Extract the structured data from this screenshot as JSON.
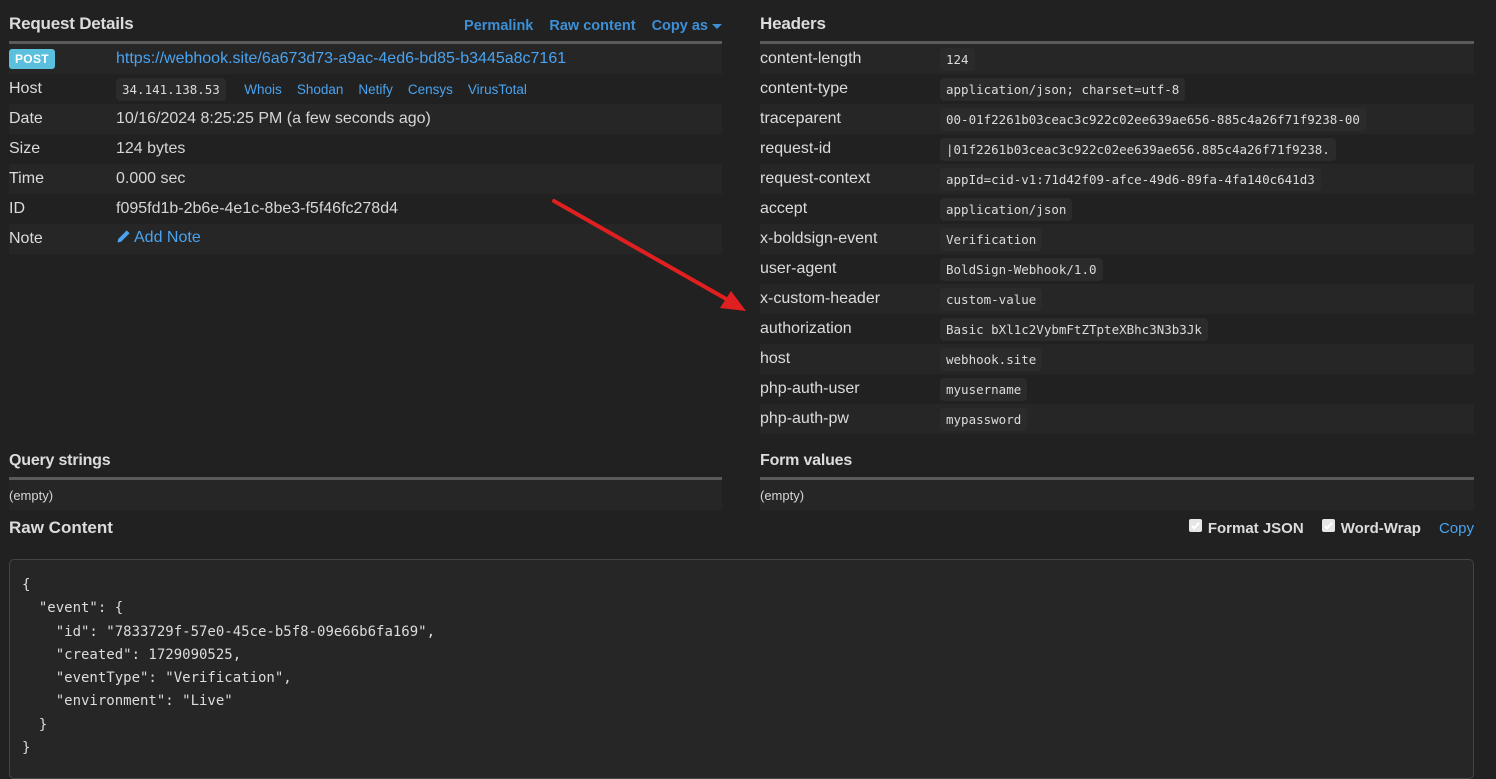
{
  "request_details": {
    "title": "Request Details",
    "links": {
      "permalink": "Permalink",
      "raw_content": "Raw content",
      "copy_as": "Copy as"
    },
    "method": "POST",
    "url": "https://webhook.site/6a673d73-a9ac-4ed6-bd85-b3445a8c7161",
    "host_label": "Host",
    "host_ip": "34.141.138.53",
    "host_links": [
      "Whois",
      "Shodan",
      "Netify",
      "Censys",
      "VirusTotal"
    ],
    "date_label": "Date",
    "date": "10/16/2024 8:25:25 PM (a few seconds ago)",
    "size_label": "Size",
    "size": "124 bytes",
    "time_label": "Time",
    "time": "0.000 sec",
    "id_label": "ID",
    "id": "f095fd1b-2b6e-4e1c-8be3-f5f46fc278d4",
    "note_label": "Note",
    "add_note": "Add Note"
  },
  "headers": {
    "title": "Headers",
    "rows": [
      {
        "key": "content-length",
        "value": "124"
      },
      {
        "key": "content-type",
        "value": "application/json; charset=utf-8"
      },
      {
        "key": "traceparent",
        "value": "00-01f2261b03ceac3c922c02ee639ae656-885c4a26f71f9238-00"
      },
      {
        "key": "request-id",
        "value": "|01f2261b03ceac3c922c02ee639ae656.885c4a26f71f9238."
      },
      {
        "key": "request-context",
        "value": "appId=cid-v1:71d42f09-afce-49d6-89fa-4fa140c641d3"
      },
      {
        "key": "accept",
        "value": "application/json"
      },
      {
        "key": "x-boldsign-event",
        "value": "Verification"
      },
      {
        "key": "user-agent",
        "value": "BoldSign-Webhook/1.0"
      },
      {
        "key": "x-custom-header",
        "value": "custom-value"
      },
      {
        "key": "authorization",
        "value": "Basic bXl1c2VybmFtZTpteXBhc3N3b3Jk"
      },
      {
        "key": "host",
        "value": "webhook.site"
      },
      {
        "key": "php-auth-user",
        "value": "myusername"
      },
      {
        "key": "php-auth-pw",
        "value": "mypassword"
      }
    ]
  },
  "query_strings": {
    "title": "Query strings",
    "value": "(empty)"
  },
  "form_values": {
    "title": "Form values",
    "value": "(empty)"
  },
  "raw_content": {
    "title": "Raw Content",
    "format_json_label": "Format JSON",
    "format_json_checked": true,
    "word_wrap_label": "Word-Wrap",
    "word_wrap_checked": true,
    "copy_label": "Copy",
    "body": "{\n  \"event\": {\n    \"id\": \"7833729f-57e0-45ce-b5f8-09e66b6fa169\",\n    \"created\": 1729090525,\n    \"eventType\": \"Verification\",\n    \"environment\": \"Live\"\n  }\n}"
  },
  "annotation": {
    "arrow_color": "#e02020",
    "points_to": "authorization"
  }
}
